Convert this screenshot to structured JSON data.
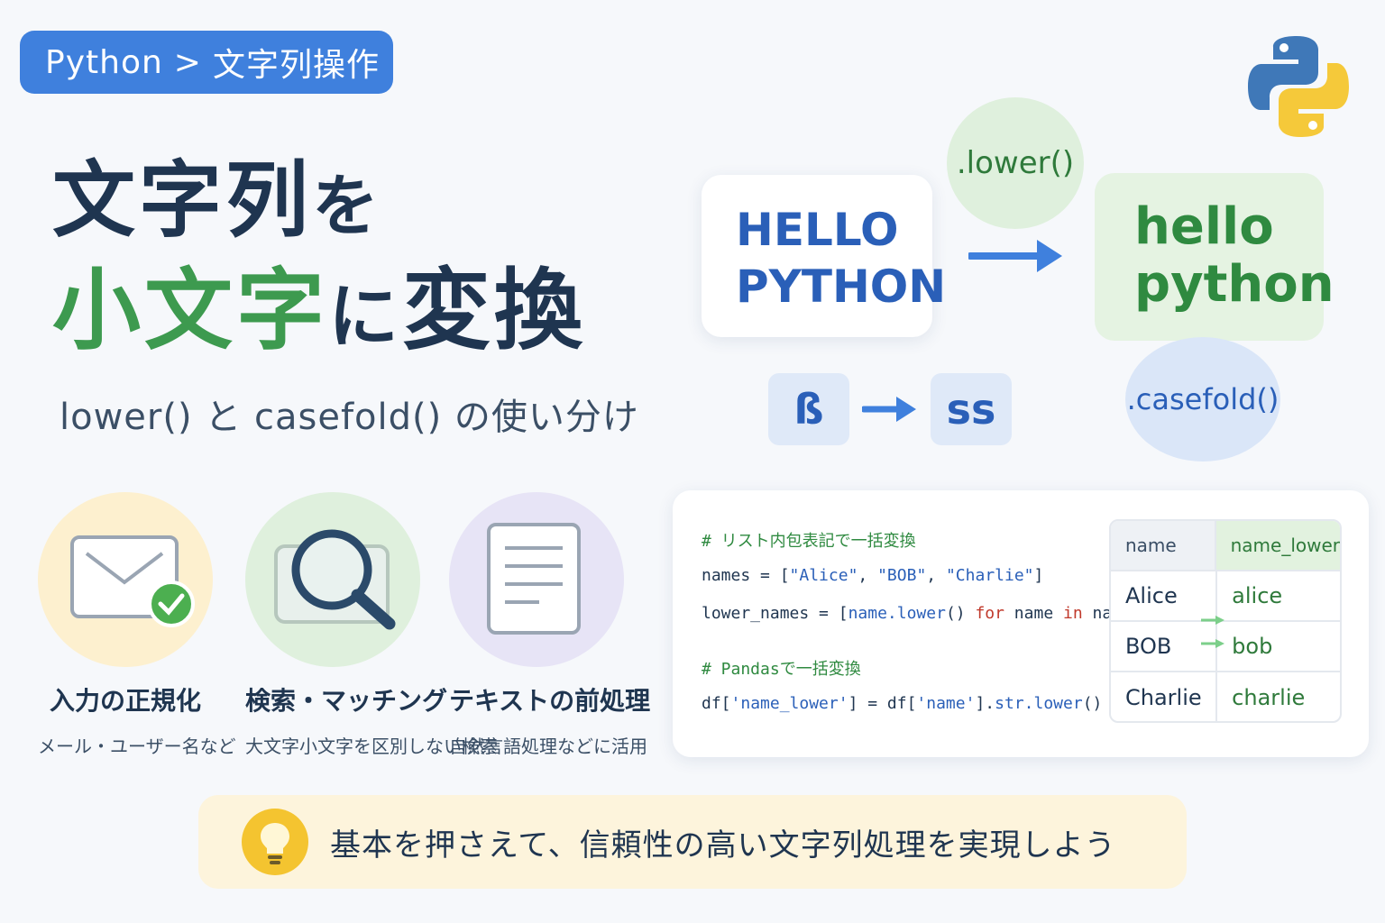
{
  "breadcrumb": {
    "root": "Python",
    "separator": ">",
    "current": "文字列操作"
  },
  "logo": {
    "icon": "python-logo-icon",
    "colors": [
      "#3f78b8",
      "#f5c93a"
    ]
  },
  "hero": {
    "title_line1_main": "文字列",
    "title_line1_particle": "を",
    "title_line2_highlight": "小文字",
    "title_line2_particle": "に",
    "title_line2_rest": "変換",
    "subtitle": "lower() と casefold() の使い分け"
  },
  "demo": {
    "input_line1": "HELLO",
    "input_line2": "PYTHON",
    "method_lower": ".lower()",
    "output_line1": "hello",
    "output_line2": "python",
    "special_input": "ß",
    "special_output": "ss",
    "method_casefold": ".casefold()"
  },
  "use_cases": [
    {
      "icon": "envelope-check-icon",
      "title": "入力の正規化",
      "subtitle": "メール・ユーザー名など",
      "color": "#fdf0cf"
    },
    {
      "icon": "magnifier-icon",
      "title": "検索・マッチング",
      "subtitle": "大文字小文字を区別しない検索",
      "color": "#dff0dd"
    },
    {
      "icon": "document-icon",
      "title": "テキストの前処理",
      "subtitle": "自然言語処理などに活用",
      "color": "#e7e4f6"
    }
  ],
  "code": {
    "comment1": "# リスト内包表記で一括変換",
    "line_names_prefix": "names = [",
    "name_values": [
      "\"Alice\"",
      "\"BOB\"",
      "\"Charlie\""
    ],
    "line_names_suffix": "]",
    "line_lower_a": "lower_names = [",
    "line_lower_b": "name.lower",
    "line_lower_c": "() ",
    "kw_for": "for",
    "line_lower_d": " name ",
    "kw_in": "in",
    "line_lower_e": " names]",
    "comment2": "# Pandasで一括変換",
    "df_a": "df[",
    "df_key1": "'name_lower'",
    "df_b": "] = df[",
    "df_key2": "'name'",
    "df_c": "].",
    "df_d": "str.lower",
    "df_e": "()"
  },
  "table": {
    "headers": [
      "name",
      "name_lower"
    ],
    "rows": [
      [
        "Alice",
        "alice"
      ],
      [
        "BOB",
        "bob"
      ],
      [
        "Charlie",
        "charlie"
      ]
    ]
  },
  "tip": {
    "icon": "lightbulb-icon",
    "text": "基本を押さえて、信頼性の高い文字列処理を実現しよう"
  }
}
